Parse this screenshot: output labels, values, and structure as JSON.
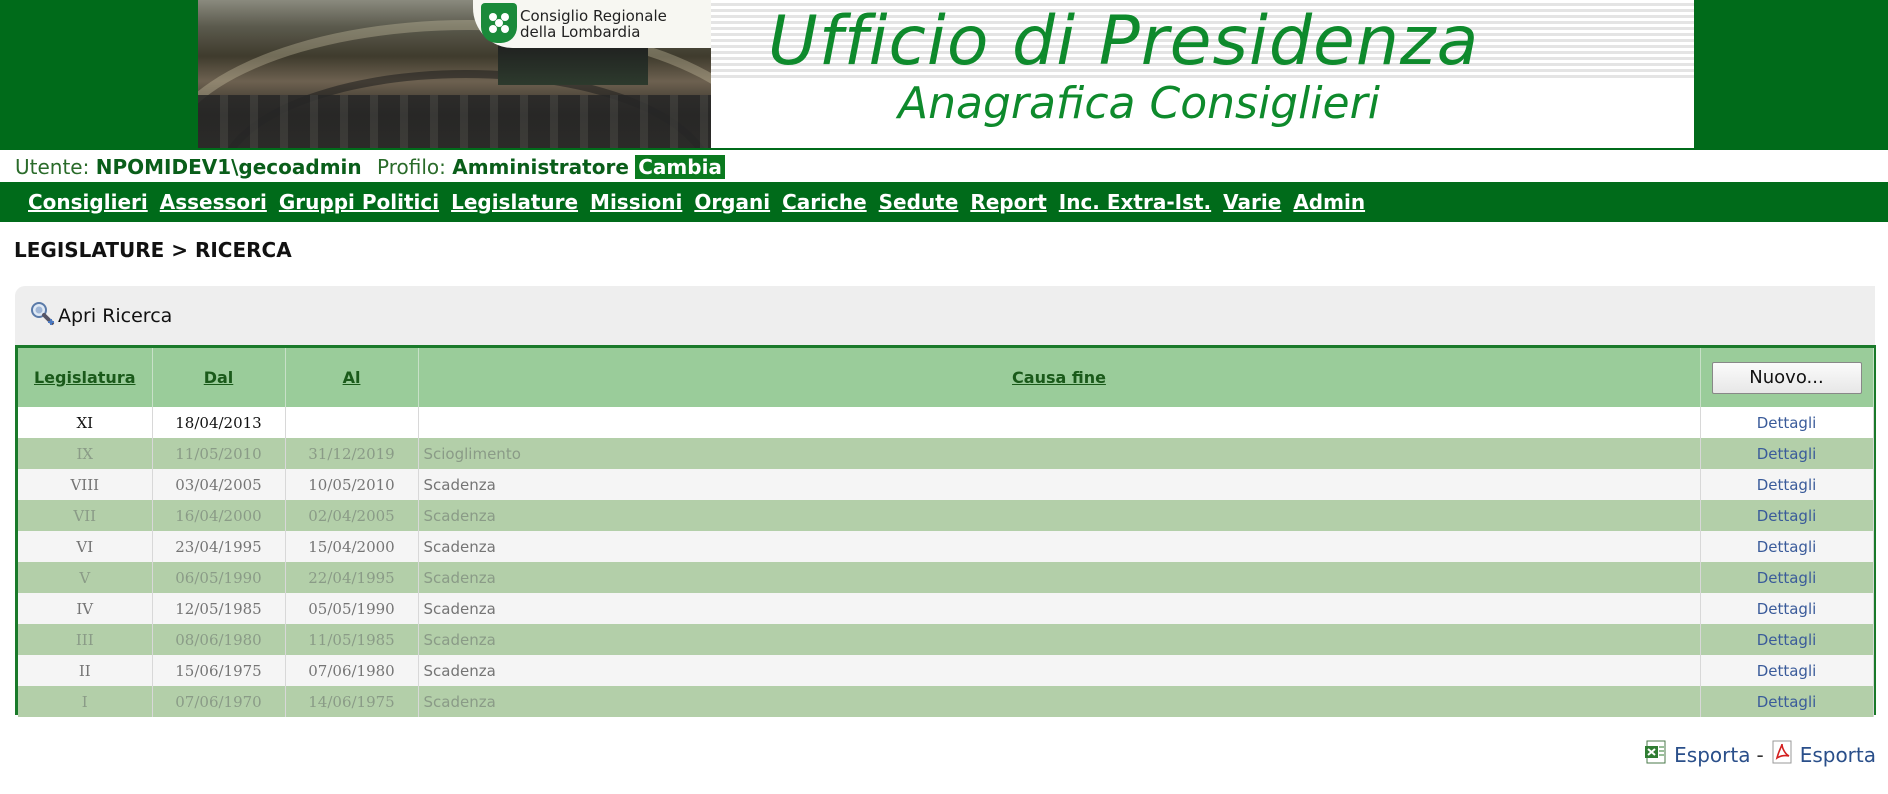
{
  "banner": {
    "logo_line1": "Consiglio Regionale",
    "logo_line2": "della Lombardia",
    "title": "Ufficio di Presidenza",
    "subtitle": "Anagrafica Consiglieri"
  },
  "userbar": {
    "user_label": "Utente:",
    "user_value": "NPOMIDEV1\\gecoadmin",
    "profile_label": "Profilo:",
    "profile_value": "Amministratore",
    "change_label": "Cambia"
  },
  "nav": {
    "items": [
      "Consiglieri",
      "Assessori",
      "Gruppi Politici",
      "Legislature",
      "Missioni",
      "Organi",
      "Cariche",
      "Sedute",
      "Report",
      "Inc. Extra-Ist.",
      "Varie",
      "Admin"
    ]
  },
  "breadcrumb": "LEGISLATURE > RICERCA",
  "search": {
    "toggle_label": "Apri Ricerca"
  },
  "table": {
    "headers": {
      "legislatura": "Legislatura",
      "dal": "Dal",
      "al": "Al",
      "causa": "Causa fine"
    },
    "new_button": "Nuovo...",
    "details_label": "Dettagli",
    "rows": [
      {
        "legislatura": "XI",
        "dal": "18/04/2013",
        "al": "",
        "causa": ""
      },
      {
        "legislatura": "IX",
        "dal": "11/05/2010",
        "al": "31/12/2019",
        "causa": "Scioglimento"
      },
      {
        "legislatura": "VIII",
        "dal": "03/04/2005",
        "al": "10/05/2010",
        "causa": "Scadenza"
      },
      {
        "legislatura": "VII",
        "dal": "16/04/2000",
        "al": "02/04/2005",
        "causa": "Scadenza"
      },
      {
        "legislatura": "VI",
        "dal": "23/04/1995",
        "al": "15/04/2000",
        "causa": "Scadenza"
      },
      {
        "legislatura": "V",
        "dal": "06/05/1990",
        "al": "22/04/1995",
        "causa": "Scadenza"
      },
      {
        "legislatura": "IV",
        "dal": "12/05/1985",
        "al": "05/05/1990",
        "causa": "Scadenza"
      },
      {
        "legislatura": "III",
        "dal": "08/06/1980",
        "al": "11/05/1985",
        "causa": "Scadenza"
      },
      {
        "legislatura": "II",
        "dal": "15/06/1975",
        "al": "07/06/1980",
        "causa": "Scadenza"
      },
      {
        "legislatura": "I",
        "dal": "07/06/1970",
        "al": "14/06/1975",
        "causa": "Scadenza"
      }
    ]
  },
  "export": {
    "excel_label": "Esporta",
    "separator": "-",
    "pdf_label": "Esporta"
  },
  "colors": {
    "brand_green": "#006b1a",
    "header_row": "#9acc9a",
    "odd_row": "#b3cfa9",
    "link": "#3a5b9a"
  },
  "icons": {
    "search": "search-magnifier-icon",
    "excel": "excel-icon",
    "pdf": "pdf-icon",
    "logo": "regional-council-logo-icon"
  }
}
